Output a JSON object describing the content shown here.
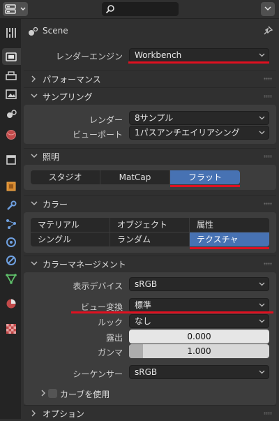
{
  "scene": {
    "name": "Scene"
  },
  "render": {
    "engine_label": "レンダーエンジン",
    "engine_value": "Workbench"
  },
  "panels": {
    "performance": "パフォーマンス",
    "sampling": "サンプリング",
    "lighting": "照明",
    "color": "カラー",
    "color_management": "カラーマネージメント",
    "options": "オプション"
  },
  "sampling": {
    "render_label": "レンダー",
    "render_value": "8サンプル",
    "viewport_label": "ビューポート",
    "viewport_value": "1パスアンチエイリアシング"
  },
  "lighting": {
    "options": [
      "スタジオ",
      "MatCap",
      "フラット"
    ],
    "selected": "フラット"
  },
  "color": {
    "options": [
      "マテリアル",
      "オブジェクト",
      "属性",
      "シングル",
      "ランダム",
      "テクスチャ"
    ],
    "selected": "テクスチャ"
  },
  "color_management": {
    "display_device_label": "表示デバイス",
    "display_device_value": "sRGB",
    "view_transform_label": "ビュー変換",
    "view_transform_value": "標準",
    "look_label": "ルック",
    "look_value": "なし",
    "exposure_label": "露出",
    "exposure_value": "0.000",
    "gamma_label": "ガンマ",
    "gamma_value": "1.000",
    "gamma_fill": 0.1,
    "sequencer_label": "シーケンサー",
    "sequencer_value": "sRGB",
    "use_curves_label": "カーブを使用"
  },
  "colors": {
    "accent": "#4772b3",
    "highlight_line": "#e01020"
  }
}
